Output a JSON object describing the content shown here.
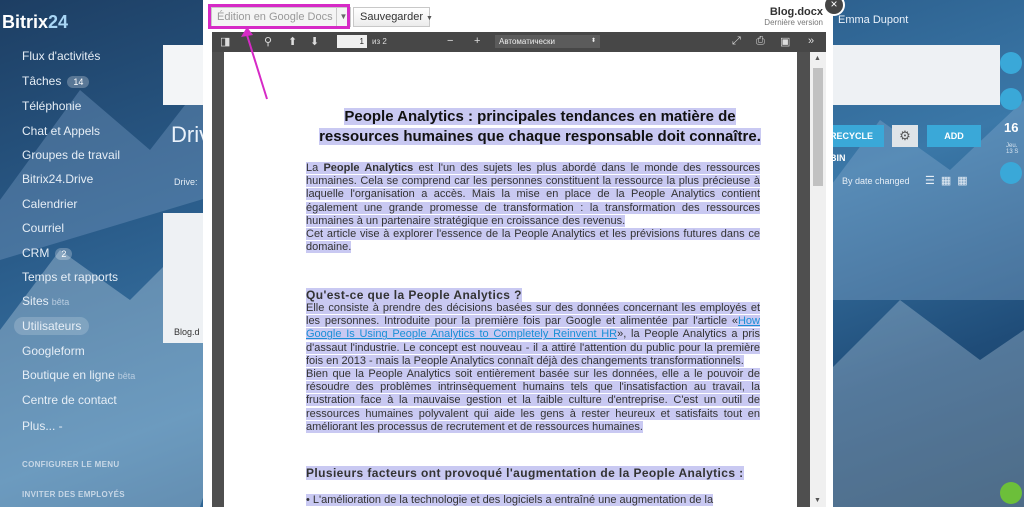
{
  "background": {
    "logo": {
      "prefix": "Bitrix",
      "suffix": "24"
    },
    "sidebar": {
      "items": [
        {
          "label": "Flux d'activités"
        },
        {
          "label": "Tâches",
          "count": "14"
        },
        {
          "label": "Téléphonie"
        },
        {
          "label": "Chat et Appels"
        },
        {
          "label": "Groupes de travail"
        },
        {
          "label": "Bitrix24.Drive"
        },
        {
          "label": "Calendrier"
        },
        {
          "label": "Courriel"
        },
        {
          "label": "CRM",
          "count": "2"
        },
        {
          "label": "Temps et rapports"
        },
        {
          "label": "Sites",
          "beta": "bêta"
        },
        {
          "label": "Utilisateurs"
        },
        {
          "label": "Googleform"
        },
        {
          "label": "Boutique en ligne",
          "beta": "bêta"
        },
        {
          "label": "Centre de contact"
        },
        {
          "label": "Plus... -"
        }
      ],
      "configure": "CONFIGURER LE MENU",
      "invite": "INVITER DES EMPLOYÉS"
    },
    "page_title": "Drive",
    "drive_label": "Drive:",
    "file_label": "Blog.d",
    "bin_button": "RECYCLE BIN",
    "add_button": "ADD",
    "sort_label": "By date changed",
    "user_name": "Emma Dupont",
    "clock": "16",
    "clock_sub": "Jeu. 13 S"
  },
  "modal": {
    "edit_button": "Édition en Google Docs",
    "save_button": "Sauvegarder",
    "file_name": "Blog.docx",
    "file_version": "Dernière version",
    "toolbar": {
      "page_current": "1",
      "page_total": "из 2",
      "zoom": "Автоматически"
    },
    "document": {
      "title": "People Analytics : principales tendances en matière de ressources humaines que chaque responsable doit connaître.",
      "p1_intro": "La ",
      "p1_bold": "People Analytics",
      "p1_rest": " est l'un des sujets les plus abordé dans le monde des ressources humaines. Cela se comprend car les personnes constituent la ressource la plus précieuse à laquelle l'organisation a accès. Mais la mise en place de la People Analytics contient également une grande promesse de transformation : la transformation des ressources humaines à un partenaire stratégique en croissance des revenus.",
      "p2": "Cet article vise à explorer l'essence de la People Analytics et les prévisions futures dans ce domaine.",
      "h1": "Qu'est-ce que la People Analytics ?",
      "p3_start": "Elle consiste à prendre des décisions basées sur des données concernant les employés et les personnes. Introduite pour la première fois par Google et alimentée par l'article «",
      "p3_link": "How Google Is Using People Analytics to Completely Reinvent HR",
      "p3_end": "», la People Analytics a pris d'assaut l'industrie. Le concept est nouveau - il a attiré l'attention du public pour la première fois en 2013 - mais la People Analytics connaît déjà des changements transformationnels.",
      "p4": "Bien que la People Analytics soit entièrement basée sur les données, elle a le pouvoir de résoudre des problèmes intrinsèquement humains tels que l'insatisfaction au travail, la frustration face à la mauvaise gestion et la faible culture d'entreprise. C'est un outil de ressources humaines polyvalent qui aide les gens à rester heureux et satisfaits tout en améliorant les processus de recrutement et de ressources humaines.",
      "h2": "Plusieurs facteurs ont provoqué l'augmentation de la People Analytics :",
      "p5": "• L'amélioration de la technologie et des logiciels a entraîné une augmentation de la"
    }
  },
  "colors": {
    "highlight": "#d62ac6",
    "selection": "#c9c9f2",
    "link": "#1a8fd6",
    "toolbar": "#474747"
  }
}
